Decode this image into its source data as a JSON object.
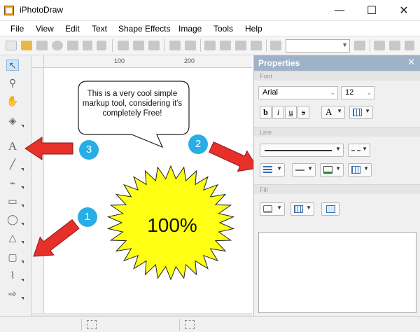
{
  "window": {
    "title": "iPhotoDraw",
    "controls": [
      "—",
      "☐",
      "✕"
    ]
  },
  "menu": [
    "File",
    "View",
    "Edit",
    "Text",
    "Shape Effects",
    "Image",
    "Tools",
    "Help"
  ],
  "properties": {
    "title": "Properties",
    "close": "✕",
    "sections": {
      "font": "Font",
      "line": "Line",
      "fill": "Fill"
    },
    "font_name": "Arial",
    "font_size": "12",
    "style_buttons": [
      "b",
      "i",
      "u",
      "s"
    ],
    "text_color_glyph": "A"
  },
  "canvas": {
    "ruler_marks": [
      "100",
      "200"
    ],
    "callout_text": "This is a very cool simple markup tool, considering it's completely Free!",
    "burst_text": "100%",
    "badges": [
      "1",
      "2",
      "3"
    ],
    "colors": {
      "arrow": "#e8302a",
      "burst": "#ffff14",
      "badge": "#27aee6"
    }
  }
}
